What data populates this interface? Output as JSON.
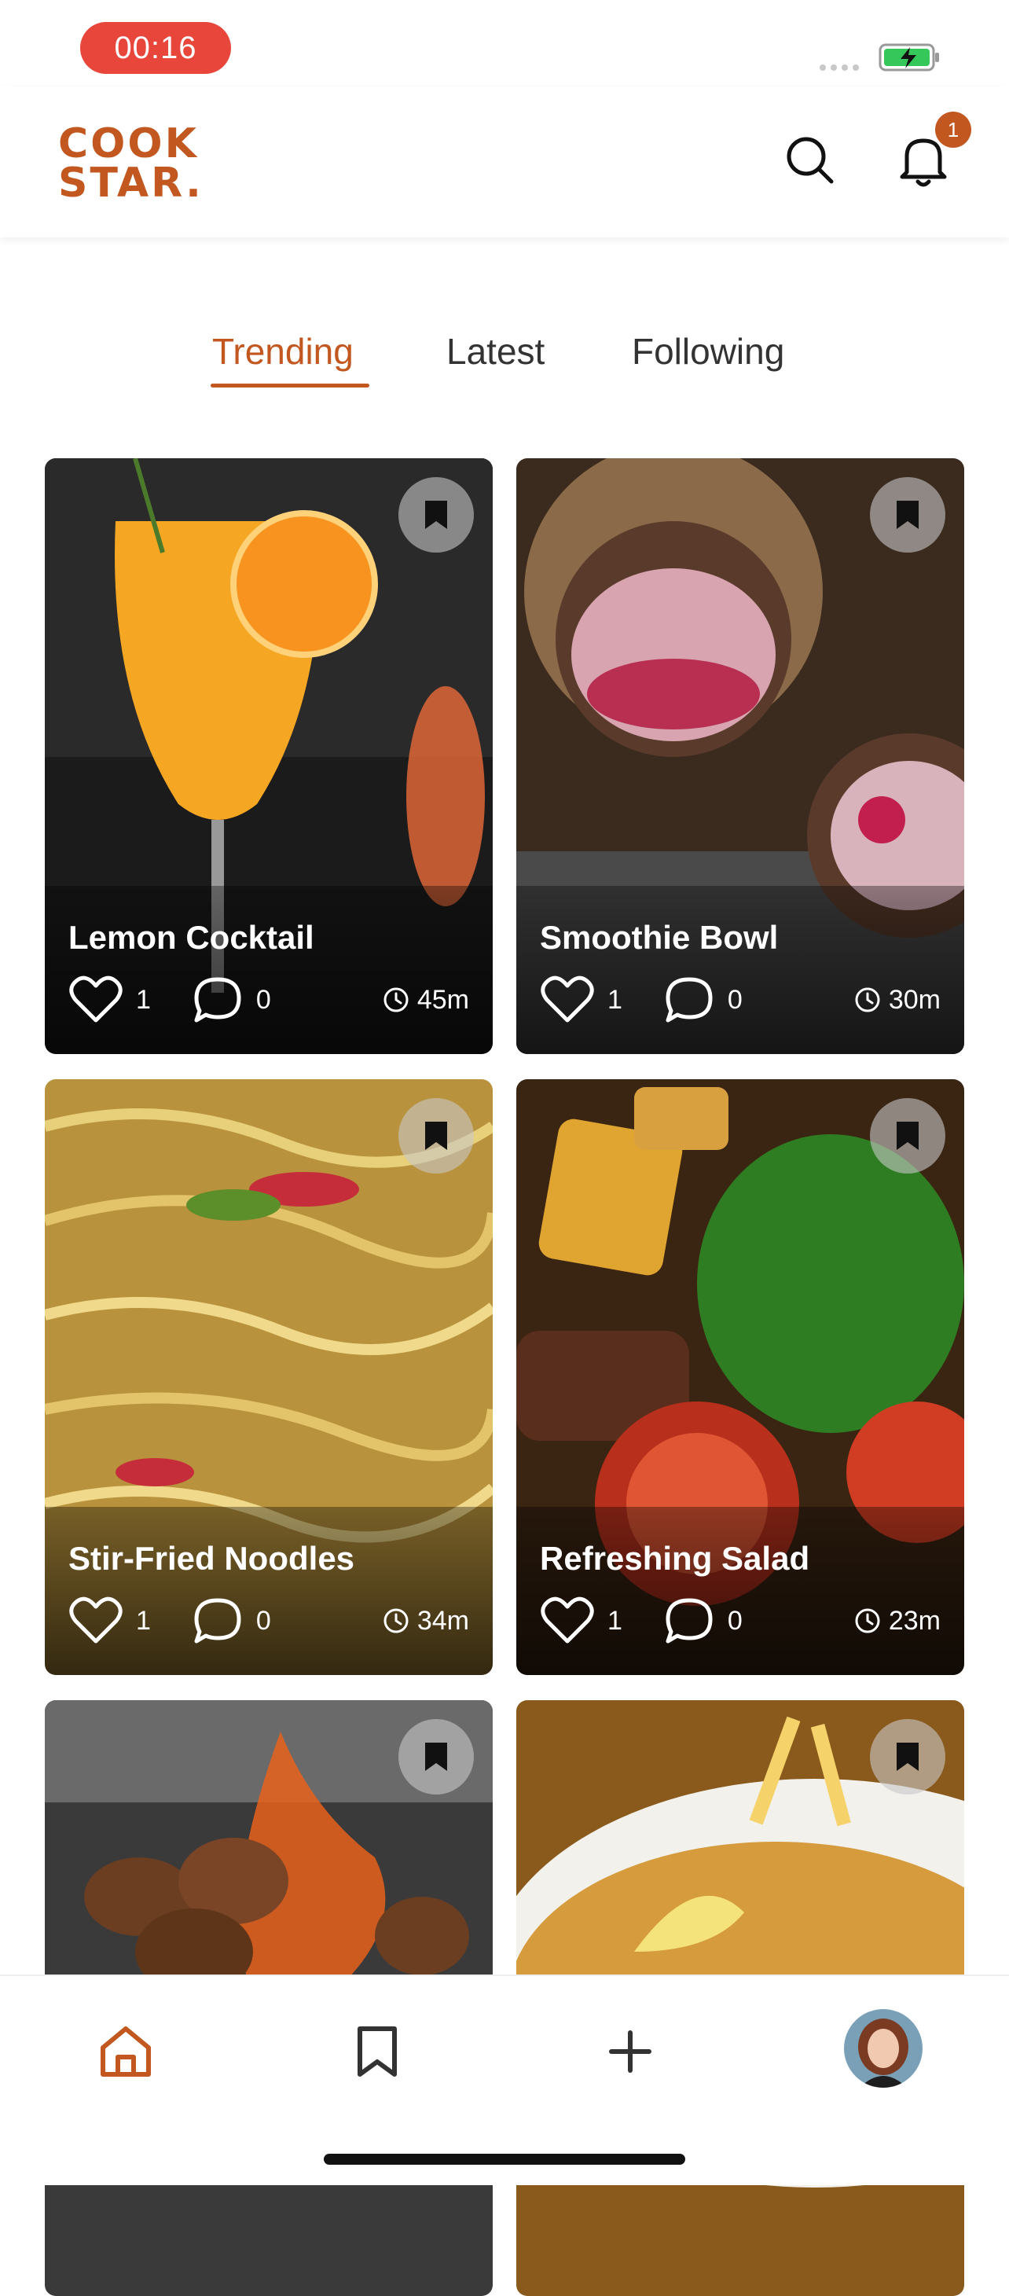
{
  "status_bar": {
    "time": "00:16"
  },
  "header": {
    "logo_line1": "COOK",
    "logo_line2": "STAR.",
    "notification_count": "1",
    "brand_color": "#c2571f"
  },
  "tabs": [
    {
      "label": "Trending",
      "active": true
    },
    {
      "label": "Latest",
      "active": false
    },
    {
      "label": "Following",
      "active": false
    }
  ],
  "recipes": [
    {
      "title": "Lemon Cocktail",
      "likes": "1",
      "comments": "0",
      "time": "45m"
    },
    {
      "title": "Smoothie Bowl",
      "likes": "1",
      "comments": "0",
      "time": "30m"
    },
    {
      "title": "Stir-Fried Noodles",
      "likes": "1",
      "comments": "0",
      "time": "34m"
    },
    {
      "title": "Refreshing Salad",
      "likes": "1",
      "comments": "0",
      "time": "23m"
    },
    {
      "title": "",
      "likes": "",
      "comments": "",
      "time": ""
    },
    {
      "title": "",
      "likes": "",
      "comments": "",
      "time": ""
    }
  ],
  "bottom_nav": [
    {
      "icon": "home-icon",
      "active": true
    },
    {
      "icon": "bookmark-icon",
      "active": false
    },
    {
      "icon": "plus-icon",
      "active": false
    },
    {
      "icon": "avatar",
      "active": false
    }
  ]
}
